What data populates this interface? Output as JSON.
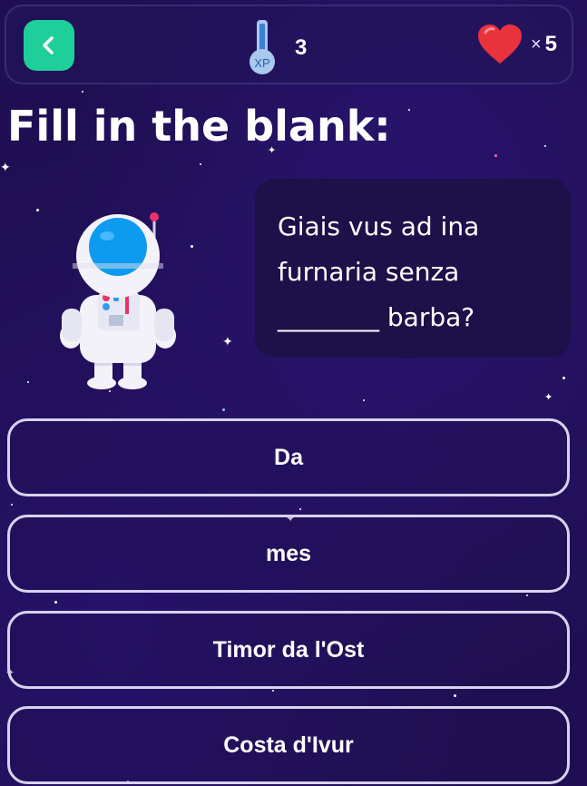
{
  "header": {
    "back_icon": "chevron-left-icon",
    "xp_icon": "xp-thermometer-icon",
    "xp_label": "XP",
    "xp_count": "3",
    "lives_icon": "heart-icon",
    "lives_multiplier": "×",
    "lives_count": "5"
  },
  "question": {
    "heading": "Fill in the blank:",
    "text_line1": "Giais vus ad ina",
    "text_line2": "furnaria senza",
    "text_line3": "________ barba?"
  },
  "options": [
    {
      "label": "Da"
    },
    {
      "label": "mes"
    },
    {
      "label": "Timor da l'Ost"
    },
    {
      "label": "Costa d'Ivur"
    }
  ],
  "colors": {
    "background": "#1f0f52",
    "back_button": "#1fcf9a",
    "heart": "#e8323c",
    "bubble": "#1e1048",
    "option_border": "#d8d2ee"
  }
}
